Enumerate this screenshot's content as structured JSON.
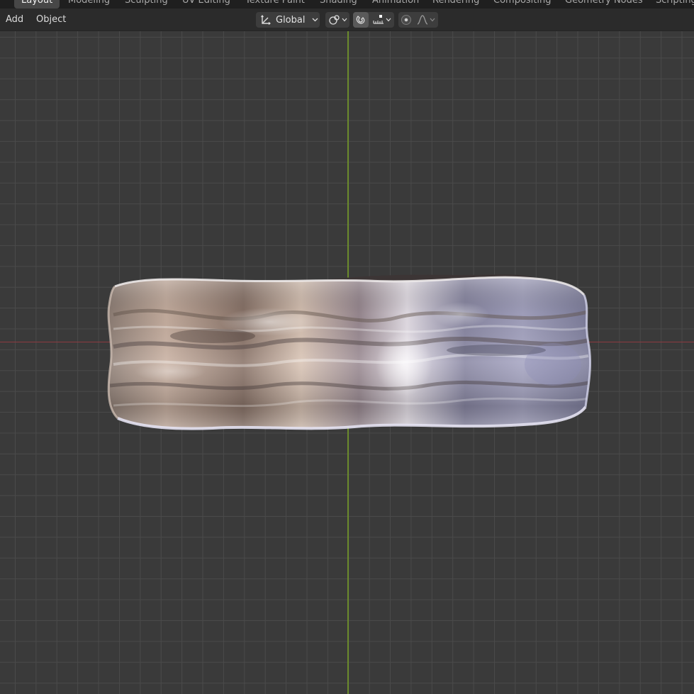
{
  "workspace_tabs": [
    {
      "label": "Layout",
      "active": true
    },
    {
      "label": "Modeling",
      "active": false
    },
    {
      "label": "Sculpting",
      "active": false
    },
    {
      "label": "UV Editing",
      "active": false
    },
    {
      "label": "Texture Paint",
      "active": false
    },
    {
      "label": "Shading",
      "active": false
    },
    {
      "label": "Animation",
      "active": false
    },
    {
      "label": "Rendering",
      "active": false
    },
    {
      "label": "Compositing",
      "active": false
    },
    {
      "label": "Geometry Nodes",
      "active": false
    },
    {
      "label": "Scripting",
      "active": false
    }
  ],
  "header": {
    "menu": {
      "add": "Add",
      "object": "Object"
    },
    "transform_orientation": {
      "value": "Global",
      "icon": "orientation-gizmo-icon",
      "dropdown_icon": "chevron-down-icon"
    },
    "pivot": {
      "icon": "pivot-point-icon"
    },
    "snap": {
      "icon": "magnet-icon",
      "active": true,
      "target_icon": "snap-increment-icon"
    },
    "proportional": {
      "icon": "proportional-edit-icon",
      "falloff_icon": "falloff-curve-icon"
    }
  },
  "viewport": {
    "object": "wrinkled-metal-ring",
    "colors": {
      "background": "#3a3a3a",
      "grid": "#4a4a4a",
      "x_axis": "#8c3a40",
      "y_axis": "#6b8a2c"
    }
  }
}
